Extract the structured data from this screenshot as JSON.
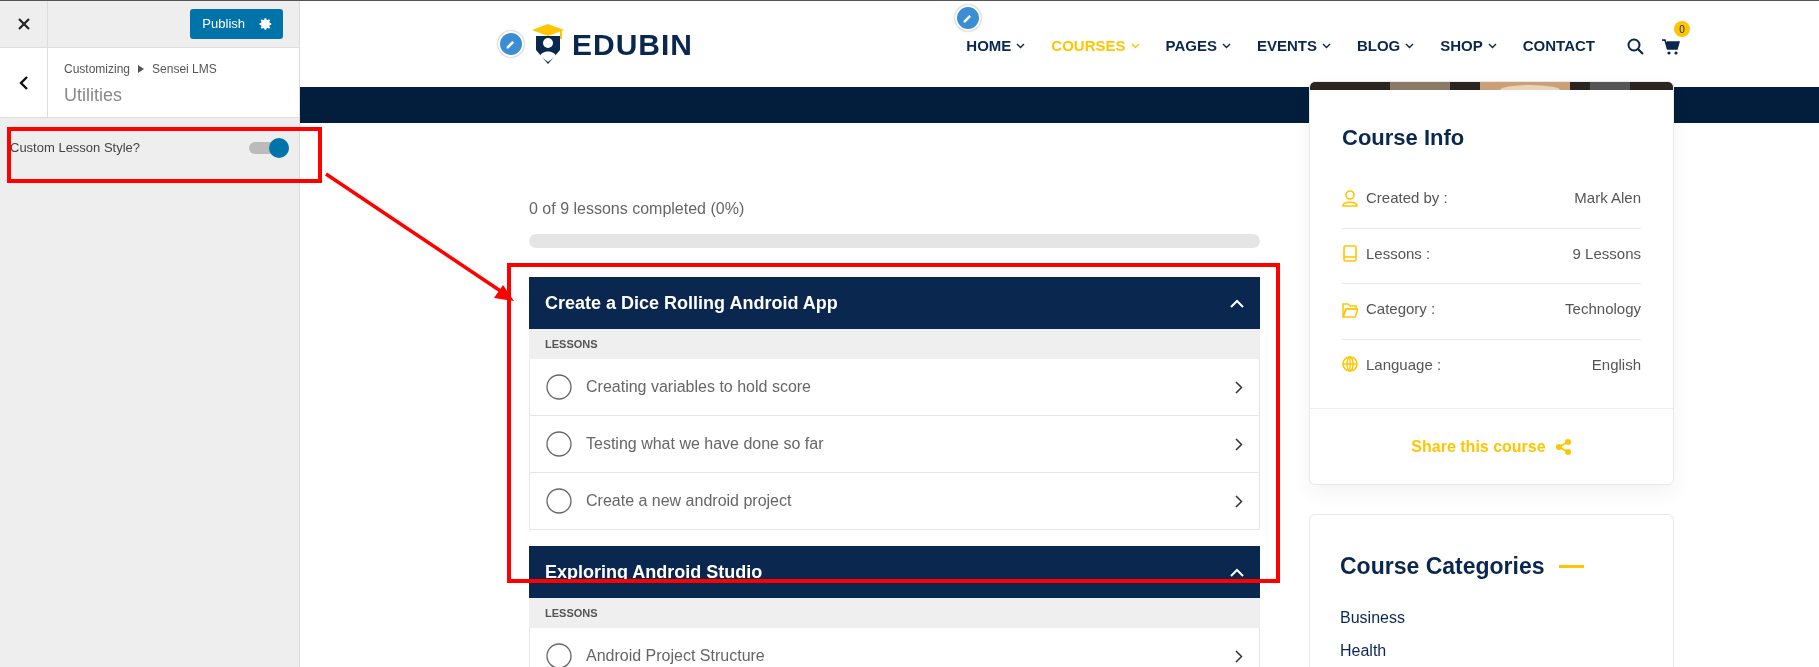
{
  "customizer": {
    "publish_button": "Publish",
    "breadcrumb": [
      "Customizing",
      "Sensei LMS"
    ],
    "section_title": "Utilities",
    "setting": {
      "label": "Custom Lesson Style?",
      "on": true
    }
  },
  "header": {
    "logo_text": "EDUBIN",
    "nav": [
      {
        "label": "HOME",
        "has_dropdown": true,
        "selected": false
      },
      {
        "label": "COURSES",
        "has_dropdown": true,
        "selected": true
      },
      {
        "label": "PAGES",
        "has_dropdown": true,
        "selected": false
      },
      {
        "label": "EVENTS",
        "has_dropdown": true,
        "selected": false
      },
      {
        "label": "BLOG",
        "has_dropdown": true,
        "selected": false
      },
      {
        "label": "SHOP",
        "has_dropdown": true,
        "selected": false
      },
      {
        "label": "CONTACT",
        "has_dropdown": false,
        "selected": false
      }
    ],
    "cart_count": "0"
  },
  "course": {
    "progress_text": "0 of 9 lessons completed (0%)",
    "progress": {
      "level": 0
    },
    "modules": [
      {
        "title": "Create a Dice Rolling Android App",
        "expanded": true,
        "lessons_label": "LESSONS",
        "lessons": [
          {
            "title": "Creating variables to hold score",
            "completed": false
          },
          {
            "title": "Testing what we have done so far",
            "completed": false
          },
          {
            "title": "Create a new android project",
            "completed": false
          }
        ]
      },
      {
        "title": "Exploring Android Studio",
        "expanded": true,
        "lessons_label": "LESSONS",
        "lessons": [
          {
            "title": "Android Project Structure",
            "completed": false
          }
        ]
      }
    ]
  },
  "course_info": {
    "title": "Course Info",
    "rows": [
      {
        "kind": "user",
        "label": "Created by :",
        "value": "Mark Alen"
      },
      {
        "kind": "book",
        "label": "Lessons :",
        "value": "9 Lessons"
      },
      {
        "kind": "folder",
        "label": "Category :",
        "value": "Technology"
      },
      {
        "kind": "globe",
        "label": "Language :",
        "value": "English"
      }
    ],
    "share": "Share this course"
  },
  "categories": {
    "title": "Course Categories",
    "items": [
      "Business",
      "Health"
    ]
  }
}
